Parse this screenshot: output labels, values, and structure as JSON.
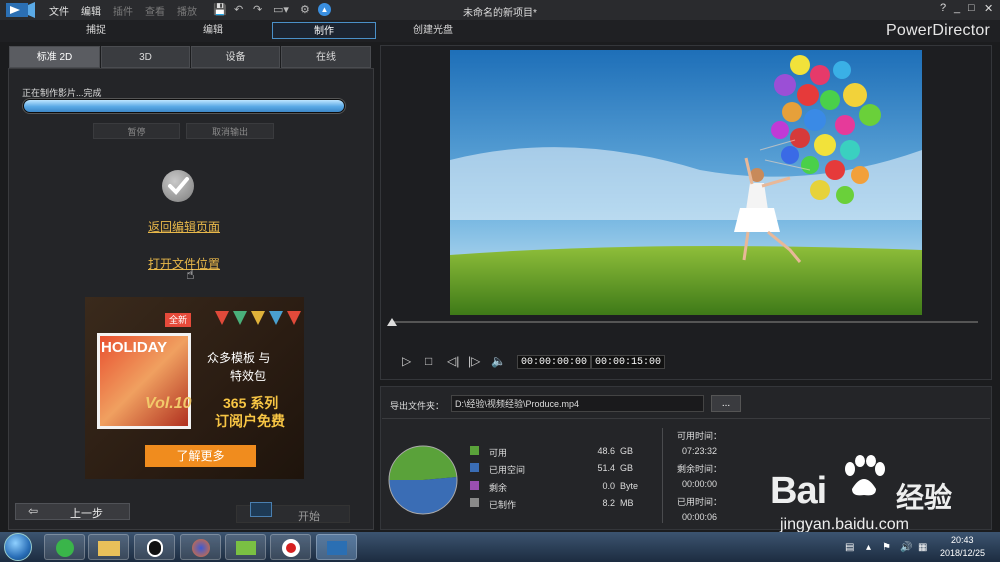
{
  "titlebar": {
    "menus": [
      "文件",
      "编辑",
      "插件",
      "查看",
      "播放"
    ],
    "document_title": "未命名的新项目*",
    "win_controls": [
      "?",
      "_",
      "□",
      "✕"
    ]
  },
  "mode_tabs": [
    "捕捉",
    "编辑",
    "制作",
    "创建光盘"
  ],
  "active_mode": "制作",
  "brand": "PowerDirector",
  "sub_tabs": [
    "标准 2D",
    "3D",
    "设备",
    "在线"
  ],
  "progress": {
    "label": "正在制作影片...完成",
    "value": 1.0
  },
  "buttons": {
    "pause": "暂停",
    "cancel_output": "取消输出",
    "prev_step": "上一步",
    "start": "开始"
  },
  "links": {
    "back_to_edit": "返回编辑页面",
    "open_file_location": "打开文件位置"
  },
  "ad": {
    "badge": "全新",
    "holiday": "HOLIDAY",
    "vol": "Vol.10",
    "line1": "众多模板 与",
    "line2": "特效包",
    "line3": "365 系列",
    "line4": "订阅户免费",
    "more": "了解更多"
  },
  "player": {
    "current_time": "00:00:00:00",
    "total_time": "00:00:15:00"
  },
  "output": {
    "label": "导出文件夹：",
    "path": "D:\\经验\\视频经验\\Produce.mp4",
    "browse": "..."
  },
  "disk": {
    "legend": [
      {
        "label": "可用",
        "value": "48.6",
        "unit": "GB",
        "color": "#5aa23a"
      },
      {
        "label": "已用空间",
        "value": "51.4",
        "unit": "GB",
        "color": "#3a6db5"
      },
      {
        "label": "剩余",
        "value": "0.0",
        "unit": "Byte",
        "color": "#9a4fb0"
      },
      {
        "label": "已制作",
        "value": "8.2",
        "unit": "MB",
        "color": "#8a8a8a"
      }
    ],
    "chart_data": {
      "type": "pie",
      "categories": [
        "可用",
        "已用空间",
        "剩余",
        "已制作"
      ],
      "values": [
        48.6,
        51.4,
        0.0,
        0.0082
      ],
      "unit": "GB"
    }
  },
  "times": {
    "available_label": "可用时间：",
    "available_value": "07:23:32",
    "remaining_label": "剩余时间：",
    "remaining_value": "00:00:00",
    "elapsed_label": "已用时间：",
    "elapsed_value": "00:00:06"
  },
  "watermark": {
    "bai": "Bai",
    "jingyan": "经验",
    "url": "jingyan.baidu.com"
  },
  "taskbar": {
    "time": "20:43",
    "date": "2018/12/25"
  }
}
